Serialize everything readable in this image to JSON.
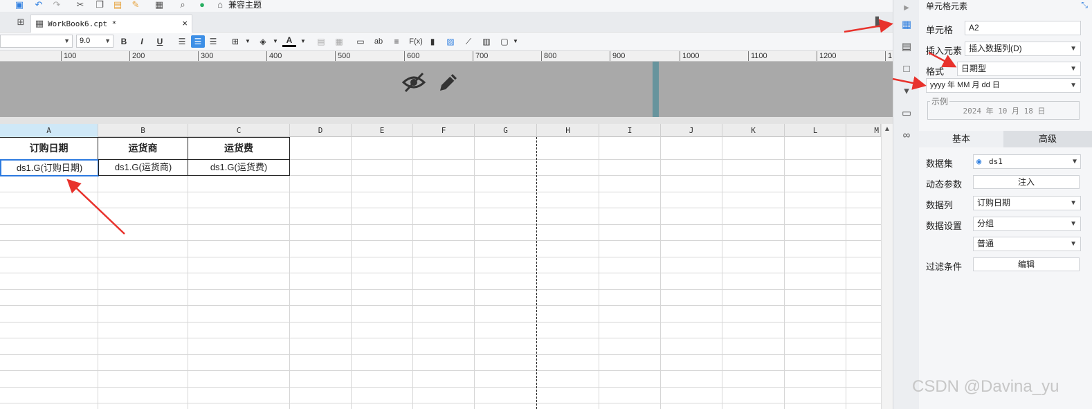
{
  "toolbar": {
    "theme_label": "兼容主题"
  },
  "tab": {
    "label": "WorkBook6.cpt *",
    "close": "×"
  },
  "format_bar": {
    "font_size": "9.0",
    "bold": "B",
    "italic": "I",
    "underline": "U",
    "text_abbr": "ab",
    "formula": "F(x)"
  },
  "ruler": {
    "ticks": [
      "100",
      "200",
      "300",
      "400",
      "500",
      "600",
      "700",
      "800",
      "900",
      "1000",
      "1100",
      "1200",
      "1"
    ]
  },
  "columns": [
    "A",
    "B",
    "C",
    "D",
    "E",
    "F",
    "G",
    "H",
    "I",
    "J",
    "K",
    "L",
    "M"
  ],
  "cells": {
    "a1": "订购日期",
    "b1": "运货商",
    "c1": "运货费",
    "a2": "ds1.G(订购日期)",
    "b2": "ds1.G(运货商)",
    "c2": "ds1.G(运货费)"
  },
  "panel": {
    "title": "单元格元素",
    "cell_label": "单元格",
    "cell_value": "A2",
    "insert_label": "插入元素",
    "insert_value": "插入数据列(D)",
    "format_label": "格式",
    "format_value": "日期型",
    "pattern_value": "yyyy 年 MM 月 dd 日",
    "example_legend": "示例",
    "example_value": "2024 年 10 月 18 日",
    "tab_basic": "基本",
    "tab_advanced": "高级",
    "dataset_label": "数据集",
    "dataset_value": "ds1",
    "dynamic_label": "动态参数",
    "inject_button": "注入",
    "column_label": "数据列",
    "column_value": "订购日期",
    "setting_label": "数据设置",
    "setting_value": "分组",
    "setting_mode": "普通",
    "filter_label": "过滤条件",
    "edit_button": "编辑"
  },
  "watermark": "CSDN @Davina_yu",
  "colors": {
    "accent": "#2f7fe0",
    "arrow": "#e8322c",
    "header_band": "#a9a9a9"
  }
}
